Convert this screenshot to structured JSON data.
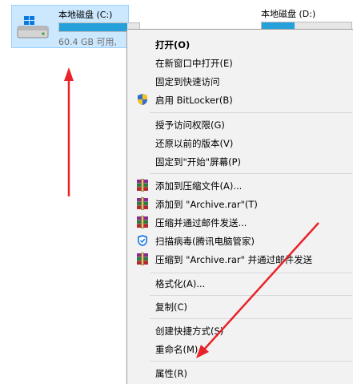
{
  "drives": [
    {
      "name": "本地磁盘 (C:)",
      "free_text": "60.4 GB 可用,",
      "usage_fraction": 0.85,
      "selected": true
    },
    {
      "name": "本地磁盘 (D:)",
      "usage_fraction": 0.37,
      "selected": false
    }
  ],
  "context_menu": {
    "items": [
      {
        "label": "打开(O)",
        "icon": ""
      },
      {
        "label": "在新窗口中打开(E)",
        "icon": ""
      },
      {
        "label": "固定到快速访问",
        "icon": ""
      },
      {
        "label": "启用 BitLocker(B)",
        "icon": "uac-shield-icon"
      },
      {
        "label": "授予访问权限(G)",
        "icon": ""
      },
      {
        "label": "还原以前的版本(V)",
        "icon": ""
      },
      {
        "label": "固定到\"开始\"屏幕(P)",
        "icon": ""
      },
      {
        "label": "添加到压缩文件(A)...",
        "icon": "winrar-icon"
      },
      {
        "label": "添加到 \"Archive.rar\"(T)",
        "icon": "winrar-icon"
      },
      {
        "label": "压缩并通过邮件发送...",
        "icon": "winrar-icon"
      },
      {
        "label": "扫描病毒(腾讯电脑管家)",
        "icon": "tencent-shield-icon"
      },
      {
        "label": "压缩到 \"Archive.rar\" 并通过邮件发送",
        "icon": "winrar-icon"
      },
      {
        "label": "格式化(A)...",
        "icon": ""
      },
      {
        "label": "复制(C)",
        "icon": ""
      },
      {
        "label": "创建快捷方式(S)",
        "icon": ""
      },
      {
        "label": "重命名(M)",
        "icon": ""
      },
      {
        "label": "属性(R)",
        "icon": ""
      }
    ]
  },
  "colors": {
    "selection_bg": "#cce8ff",
    "menu_bg": "#f2f2f2",
    "usage_bar": "#26a0da",
    "annotation_arrow": "#e8232a"
  }
}
